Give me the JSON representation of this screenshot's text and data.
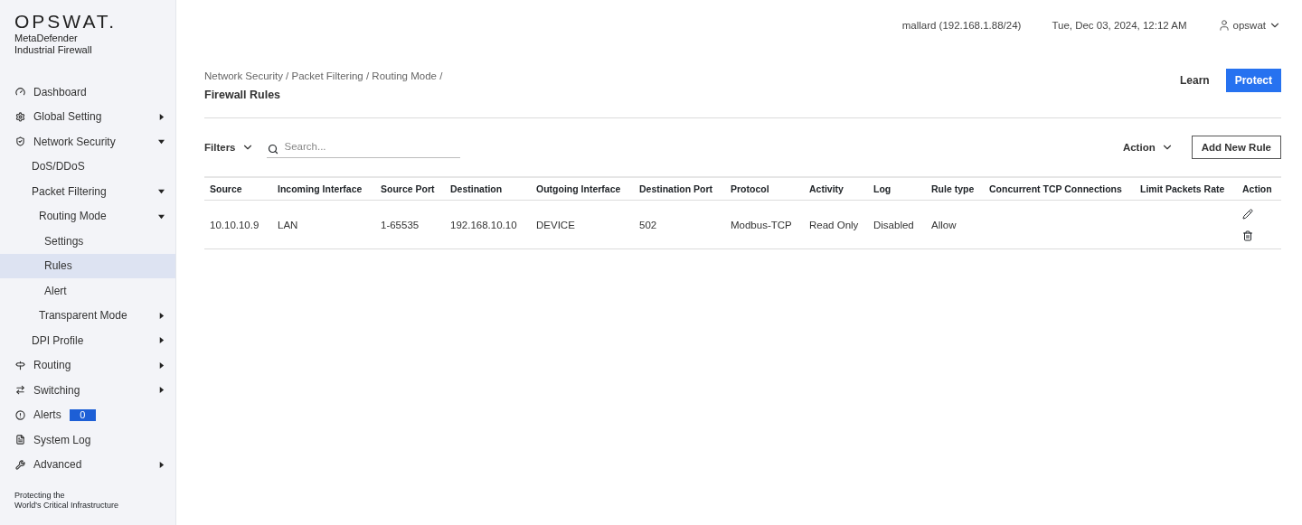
{
  "brand": {
    "logo": "OPSWAT.",
    "product": "MetaDefender",
    "subtitle": "Industrial Firewall"
  },
  "sidebar": {
    "items": [
      {
        "label": "Dashboard",
        "selected": false
      },
      {
        "label": "Global Setting",
        "selected": false,
        "expanded": false
      },
      {
        "label": "Network Security",
        "selected": false,
        "expanded": true,
        "children": [
          {
            "label": "DoS/DDoS",
            "selected": false
          },
          {
            "label": "Packet Filtering",
            "selected": false,
            "expanded": true,
            "children": [
              {
                "label": "Routing Mode",
                "selected": false,
                "expanded": true,
                "children": [
                  {
                    "label": "Settings",
                    "selected": false
                  },
                  {
                    "label": "Rules",
                    "selected": true
                  },
                  {
                    "label": "Alert",
                    "selected": false
                  }
                ]
              },
              {
                "label": "Transparent Mode",
                "selected": false,
                "expanded": false
              }
            ]
          },
          {
            "label": "DPI Profile",
            "selected": false,
            "expanded": false
          }
        ]
      },
      {
        "label": "Routing",
        "selected": false,
        "expanded": false
      },
      {
        "label": "Switching",
        "selected": false,
        "expanded": false
      },
      {
        "label": "Alerts",
        "selected": false,
        "badge": "0"
      },
      {
        "label": "System Log",
        "selected": false
      },
      {
        "label": "Advanced",
        "selected": false,
        "expanded": false
      }
    ],
    "footer": [
      "Protecting the",
      "World's Critical Infrastructure"
    ]
  },
  "topbar": {
    "device": "mallard (192.168.1.88/24)",
    "datetime": "Tue, Dec 03, 2024, 12:12 AM",
    "user": "opswat"
  },
  "breadcrumb": "Network Security / Packet Filtering / Routing Mode /",
  "title": "Firewall Rules",
  "modes": [
    {
      "label": "Learn",
      "selected": false
    },
    {
      "label": "Protect",
      "selected": true
    }
  ],
  "toolbar": {
    "filters": "Filters",
    "search": {
      "placeholder": "Search..."
    },
    "action": "Action",
    "add_button": "Add New Rule"
  },
  "table": {
    "columns": [
      "Source",
      "Incoming Interface",
      "Source Port",
      "Destination",
      "Outgoing Interface",
      "Destination Port",
      "Protocol",
      "Activity",
      "Log",
      "Rule type",
      "Concurrent TCP Connections",
      "Limit Packets Rate",
      "Action"
    ],
    "rows": [
      {
        "cells": [
          "10.10.10.9",
          "LAN",
          "1-65535",
          "192.168.10.10",
          "DEVICE",
          "502",
          "Modbus-TCP",
          "Read Only",
          "Disabled",
          "Allow"
        ]
      }
    ]
  }
}
